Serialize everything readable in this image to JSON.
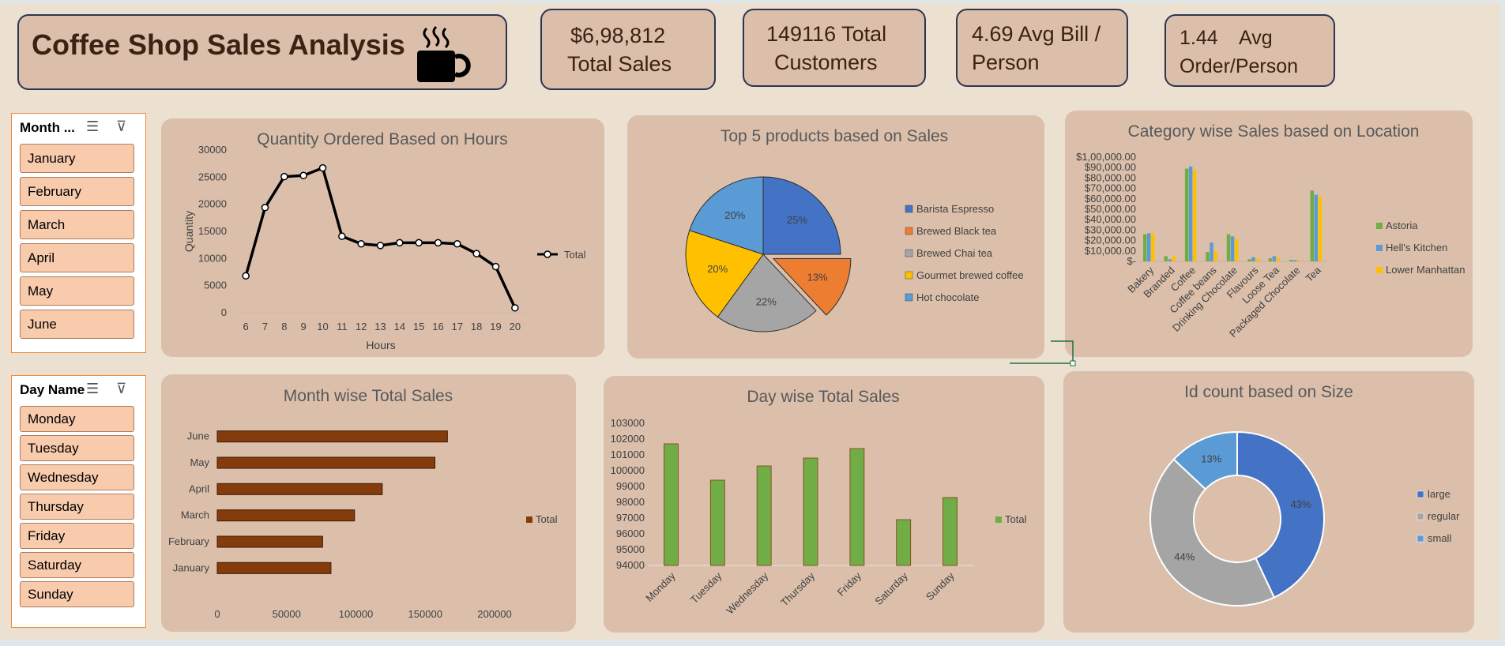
{
  "header": {
    "title": "Coffee Shop Sales Analysis",
    "kpis": [
      {
        "line1": "$6,98,812",
        "line2": "Total Sales"
      },
      {
        "line1": "149116 Total",
        "line2": "Customers"
      },
      {
        "line1": "4.69 Avg Bill /",
        "line2": "Person"
      },
      {
        "line1": "1.44    Avg",
        "line2": "Order/Person"
      }
    ]
  },
  "slicers": {
    "month": {
      "header": "Month ...",
      "items": [
        "January",
        "February",
        "March",
        "April",
        "May",
        "June"
      ]
    },
    "day": {
      "header": "Day Name",
      "items": [
        "Monday",
        "Tuesday",
        "Wednesday",
        "Thursday",
        "Friday",
        "Saturday",
        "Sunday"
      ]
    }
  },
  "colors": {
    "accent_brown": "#843c0c",
    "green": "#70ad47",
    "blue": "#4472c4",
    "orange": "#ed7d31",
    "gray": "#a5a5a5",
    "gold": "#ffc000",
    "lightblue": "#5b9bd5",
    "panel": "#dbbfab",
    "page": "#ece0d1"
  },
  "chart_data": [
    {
      "id": "hours",
      "type": "line",
      "title": "Quantity Ordered Based on Hours",
      "xlabel": "Hours",
      "ylabel": "Quantity",
      "x": [
        6,
        7,
        8,
        9,
        10,
        11,
        12,
        13,
        14,
        15,
        16,
        17,
        18,
        19,
        20
      ],
      "series": [
        {
          "name": "Total",
          "values": [
            6800,
            19400,
            25100,
            25300,
            26700,
            14100,
            12700,
            12400,
            12900,
            12900,
            12900,
            12700,
            10900,
            8500,
            900
          ]
        }
      ],
      "ylim": [
        0,
        30000
      ],
      "yticks": [
        "0",
        "5000",
        "10000",
        "15000",
        "20000",
        "25000",
        "30000"
      ],
      "legend": "right"
    },
    {
      "id": "products",
      "type": "pie",
      "title": "Top 5 products based on Sales",
      "labels": [
        "Barista Espresso",
        "Brewed Black tea",
        "Brewed Chai tea",
        "Gourmet brewed coffee",
        "Hot chocolate"
      ],
      "values": [
        25,
        13,
        22,
        20,
        20
      ],
      "value_labels": [
        "25%",
        "13%",
        "22%",
        "20%",
        "20%"
      ],
      "legend": "right"
    },
    {
      "id": "category",
      "type": "bar",
      "title": "Category wise Sales based on Location",
      "categories": [
        "Bakery",
        "Branded",
        "Coffee",
        "Coffee beans",
        "Drinking Chocolate",
        "Flavours",
        "Loose Tea",
        "Packaged Chocolate",
        "Tea"
      ],
      "series": [
        {
          "name": "Astoria",
          "values": [
            26000,
            5000,
            89000,
            9000,
            26000,
            2000,
            3000,
            1500,
            68000
          ]
        },
        {
          "name": "Hell's Kitchen",
          "values": [
            27000,
            2000,
            91000,
            18000,
            24000,
            4000,
            5000,
            1200,
            64000
          ]
        },
        {
          "name": "Lower Manhattan",
          "values": [
            27000,
            5000,
            88000,
            10000,
            22000,
            3000,
            3500,
            1300,
            62000
          ]
        }
      ],
      "ylim": [
        0,
        100000
      ],
      "yticks": [
        "$-",
        "$10,000.00",
        "$20,000.00",
        "$30,000.00",
        "$40,000.00",
        "$50,000.00",
        "$60,000.00",
        "$70,000.00",
        "$80,000.00",
        "$90,000.00",
        "$1,00,000.00"
      ],
      "legend": "right"
    },
    {
      "id": "month",
      "type": "bar",
      "orientation": "horizontal",
      "title": "Month wise Total Sales",
      "categories": [
        "January",
        "February",
        "March",
        "April",
        "May",
        "June"
      ],
      "series": [
        {
          "name": "Total",
          "values": [
            82000,
            76000,
            99000,
            119000,
            157000,
            166000
          ]
        }
      ],
      "xlim": [
        0,
        200000
      ],
      "xticks": [
        "0",
        "50000",
        "100000",
        "150000",
        "200000"
      ],
      "legend": "right"
    },
    {
      "id": "day",
      "type": "bar",
      "title": "Day wise Total Sales",
      "categories": [
        "Monday",
        "Tuesday",
        "Wednesday",
        "Thursday",
        "Friday",
        "Saturday",
        "Sunday"
      ],
      "series": [
        {
          "name": "Total",
          "values": [
            101700,
            99400,
            100300,
            100800,
            101400,
            96900,
            98300
          ]
        }
      ],
      "ylim": [
        94000,
        103000
      ],
      "yticks": [
        "94000",
        "95000",
        "96000",
        "97000",
        "98000",
        "99000",
        "100000",
        "101000",
        "102000",
        "103000"
      ],
      "legend": "right"
    },
    {
      "id": "size",
      "type": "pie",
      "subtype": "doughnut",
      "title": "Id count based on Size",
      "labels": [
        "large",
        "regular",
        "small"
      ],
      "values": [
        43,
        44,
        13
      ],
      "value_labels": [
        "43%",
        "44%",
        "13%"
      ],
      "legend": "right"
    }
  ]
}
